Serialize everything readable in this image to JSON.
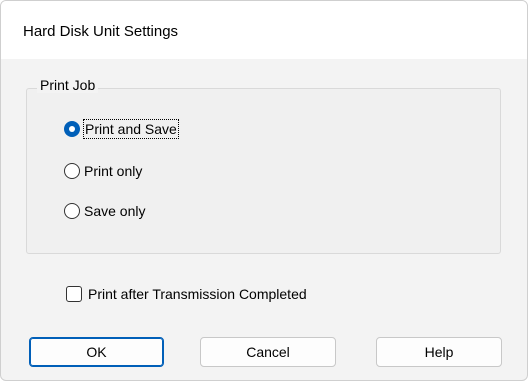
{
  "dialog": {
    "title": "Hard Disk Unit Settings"
  },
  "print_job": {
    "group_label": "Print Job",
    "options": [
      {
        "label": "Print and Save",
        "checked": true
      },
      {
        "label": "Print only",
        "checked": false
      },
      {
        "label": "Save only",
        "checked": false
      }
    ]
  },
  "checkbox": {
    "label": "Print after Transmission Completed",
    "checked": false
  },
  "buttons": {
    "ok": "OK",
    "cancel": "Cancel",
    "help": "Help"
  },
  "colors": {
    "accent": "#005fb8"
  }
}
